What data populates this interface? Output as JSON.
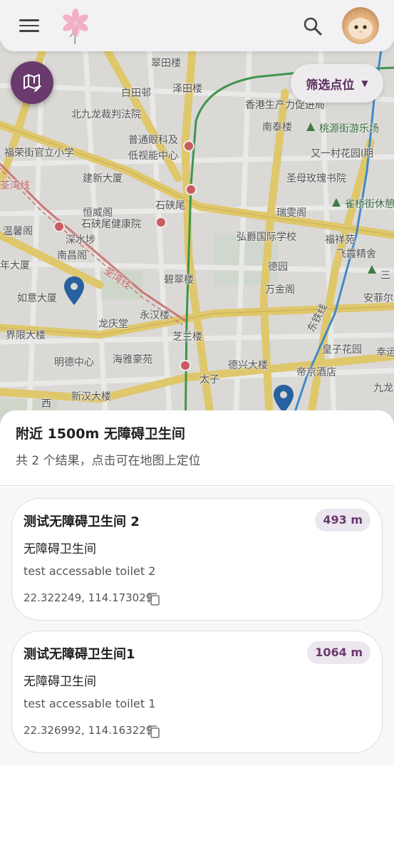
{
  "map": {
    "labels": [
      "翠田楼",
      "白田邨",
      "泽田楼",
      "香港生产力促进局",
      "北九龙裁判法院",
      "桃源街游乐场",
      "普通眼科及",
      "低视能中心",
      "南泰楼",
      "又一村花园I期",
      "福荣街官立小学",
      "建新大厦",
      "圣母玫瑰书院",
      "荃湾线",
      "恒威阁",
      "石硖尾",
      "瑞雯阁",
      "雀桥街休憩处",
      "温馨阁",
      "石硖尾健康院",
      "深水埗",
      "弘爵国际学校",
      "福祥苑",
      "南昌阁",
      "飞霞精舍",
      "德园",
      "三",
      "年大厦",
      "荃湾线",
      "碧翠楼",
      "万金阁",
      "如意大厦",
      "永汉楼",
      "安菲尔",
      "龙庆堂",
      "东铁线",
      "界限大楼",
      "芝兰楼",
      "皇子花园",
      "幸运",
      "明德中心",
      "海雅豪苑",
      "德兴大楼",
      "帝京酒店",
      "太子",
      "九龙",
      "新汉大楼",
      "西"
    ]
  },
  "appbar": {
    "menu_icon": "menu-icon",
    "logo_icon": "flower-logo-icon",
    "search_icon": "search-icon",
    "avatar_icon": "cat-avatar"
  },
  "fab": {
    "icon": "map-edit-icon"
  },
  "filter": {
    "label": "筛选点位",
    "caret": "▼"
  },
  "sheet": {
    "title": "附近 1500m 无障碍卫生间",
    "subtitle": "共 2 个结果，点击可在地图上定位"
  },
  "results": [
    {
      "title": "测试无障碍卫生间 2",
      "distance": "493 m",
      "type": "无障碍卫生间",
      "description": "test accessable toilet 2",
      "coords": "22.322249, 114.173029"
    },
    {
      "title": "测试无障碍卫生间1",
      "distance": "1064 m",
      "type": "无障碍卫生间",
      "description": "test accessable toilet 1",
      "coords": "22.326992, 114.163229"
    }
  ],
  "colors": {
    "accent": "#6a3a6e",
    "pin": "#1f5fa8",
    "green_line": "#3a9a4a",
    "red_line": "#d46a6a",
    "blue_line": "#3b8fd6",
    "road_yellow": "#f2d56e"
  }
}
